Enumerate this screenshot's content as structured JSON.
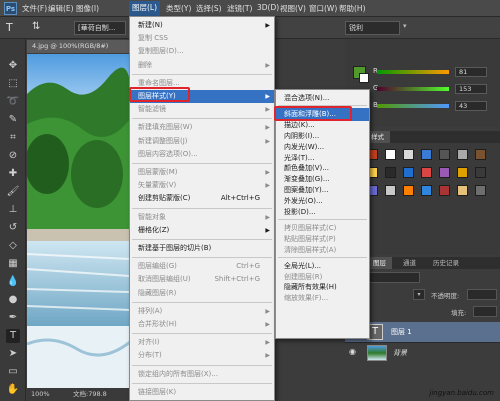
{
  "menubar": {
    "logo": "Ps",
    "items": [
      {
        "label": "文件(F)"
      },
      {
        "label": "编辑(E)"
      },
      {
        "label": "图像(I)"
      },
      {
        "label": "图层(L)"
      },
      {
        "label": "类型(Y)"
      },
      {
        "label": "选择(S)"
      },
      {
        "label": "滤镜(T)"
      },
      {
        "label": "3D(D)"
      },
      {
        "label": "视图(V)"
      },
      {
        "label": "窗口(W)"
      },
      {
        "label": "帮助(H)"
      }
    ]
  },
  "options": {
    "font_value": "[華荷自制...",
    "style_value": "锐利"
  },
  "document": {
    "tab_title": "4.jpg @ 100%(RGB/8#)",
    "zoom": "100%",
    "doc_info": "文档:798.8"
  },
  "layer_menu": {
    "items": [
      {
        "label": "新建(N)",
        "type": "item",
        "arrow": true
      },
      {
        "label": "复制 CSS",
        "type": "item",
        "disabled": true
      },
      {
        "label": "复制图层(D)...",
        "type": "item",
        "disabled": true
      },
      {
        "label": "删除",
        "type": "item",
        "disabled": true,
        "arrow": true
      },
      {
        "type": "sep"
      },
      {
        "label": "重命名图层...",
        "type": "item",
        "disabled": true
      },
      {
        "label": "图层样式(Y)",
        "type": "item",
        "arrow": true,
        "highlight": true
      },
      {
        "label": "智能滤镜",
        "type": "item",
        "disabled": true,
        "arrow": true
      },
      {
        "type": "sep"
      },
      {
        "label": "新建填充图层(W)",
        "type": "item",
        "disabled": true,
        "arrow": true
      },
      {
        "label": "新建调整图层(J)",
        "type": "item",
        "disabled": true,
        "arrow": true
      },
      {
        "label": "图层内容选项(O)...",
        "type": "item",
        "disabled": true
      },
      {
        "type": "sep"
      },
      {
        "label": "图层蒙版(M)",
        "type": "item",
        "disabled": true,
        "arrow": true
      },
      {
        "label": "矢量蒙版(V)",
        "type": "item",
        "disabled": true,
        "arrow": true
      },
      {
        "label": "创建剪贴蒙版(C)",
        "type": "item",
        "shortcut": "Alt+Ctrl+G"
      },
      {
        "type": "sep"
      },
      {
        "label": "智能对象",
        "type": "item",
        "disabled": true,
        "arrow": true
      },
      {
        "label": "栅格化(Z)",
        "type": "item",
        "arrow": true
      },
      {
        "type": "sep"
      },
      {
        "label": "新建基于图层的切片(B)",
        "type": "item"
      },
      {
        "type": "sep"
      },
      {
        "label": "图层编组(G)",
        "type": "item",
        "disabled": true,
        "shortcut": "Ctrl+G"
      },
      {
        "label": "取消图层编组(U)",
        "type": "item",
        "disabled": true,
        "shortcut": "Shift+Ctrl+G"
      },
      {
        "label": "隐藏图层(R)",
        "type": "item",
        "disabled": true
      },
      {
        "type": "sep"
      },
      {
        "label": "排列(A)",
        "type": "item",
        "disabled": true,
        "arrow": true
      },
      {
        "label": "合并形状(H)",
        "type": "item",
        "disabled": true,
        "arrow": true
      },
      {
        "type": "sep"
      },
      {
        "label": "对齐(I)",
        "type": "item",
        "disabled": true,
        "arrow": true
      },
      {
        "label": "分布(T)",
        "type": "item",
        "disabled": true,
        "arrow": true
      },
      {
        "type": "sep"
      },
      {
        "label": "锁定组内的所有图层(X)...",
        "type": "item",
        "disabled": true
      },
      {
        "type": "sep"
      },
      {
        "label": "链接图层(K)",
        "type": "item",
        "disabled": true
      }
    ]
  },
  "style_menu": {
    "items": [
      {
        "label": "混合选项(N)...",
        "type": "item"
      },
      {
        "type": "sep"
      },
      {
        "label": "斜面和浮雕(B)...",
        "type": "item",
        "highlight": true
      },
      {
        "label": "描边(K)...",
        "type": "item"
      },
      {
        "label": "内阴影(I)...",
        "type": "item"
      },
      {
        "label": "内发光(W)...",
        "type": "item"
      },
      {
        "label": "光泽(T)...",
        "type": "item"
      },
      {
        "label": "颜色叠加(V)...",
        "type": "item"
      },
      {
        "label": "渐变叠加(G)...",
        "type": "item"
      },
      {
        "label": "图案叠加(Y)...",
        "type": "item"
      },
      {
        "label": "外发光(O)...",
        "type": "item"
      },
      {
        "label": "投影(D)...",
        "type": "item"
      },
      {
        "type": "sep"
      },
      {
        "label": "拷贝图层样式(C)",
        "type": "item",
        "disabled": true
      },
      {
        "label": "粘贴图层样式(P)",
        "type": "item",
        "disabled": true
      },
      {
        "label": "清除图层样式(A)",
        "type": "item",
        "disabled": true
      },
      {
        "type": "sep"
      },
      {
        "label": "全局光(L)...",
        "type": "item"
      },
      {
        "label": "创建图层(R)",
        "type": "item",
        "disabled": true
      },
      {
        "label": "隐藏所有效果(H)",
        "type": "item"
      },
      {
        "label": "缩放效果(F)...",
        "type": "item",
        "disabled": true
      }
    ]
  },
  "color_panel": {
    "r_label": "R",
    "r_value": "81",
    "g_label": "G",
    "g_value": "153",
    "b_label": "B",
    "b_value": "43",
    "foreground": "#51992b",
    "background": "#ffffff"
  },
  "styles_panel": {
    "tab": "样式",
    "swatch_colors": [
      "#c2401e",
      "#ffffff",
      "#d8d8d8",
      "#3a7bd5",
      "#555555",
      "#a9a9a9",
      "#7a5230",
      "#ffd24a",
      "#2a2a2a",
      "#1f6fd1",
      "#d44",
      "#9b59b6",
      "#e0a000",
      "#3a3a3a",
      "#6b6bd6",
      "#c9c9c9",
      "#ff7f00",
      "#2e86de",
      "#a33",
      "#e6c17a",
      "#6e6e6e"
    ]
  },
  "layers_panel": {
    "tabs": [
      "图层",
      "通道",
      "历史记录"
    ],
    "opacity_label": "不透明度:",
    "fill_label": "填充:",
    "layers": [
      {
        "name": "图层 1",
        "type": "text"
      },
      {
        "name": "背景",
        "type": "image"
      }
    ]
  },
  "colors": {
    "menu_highlight": "#3672c4",
    "annotation_red": "#e0242c"
  },
  "watermark": "jingyan.baidu.com"
}
